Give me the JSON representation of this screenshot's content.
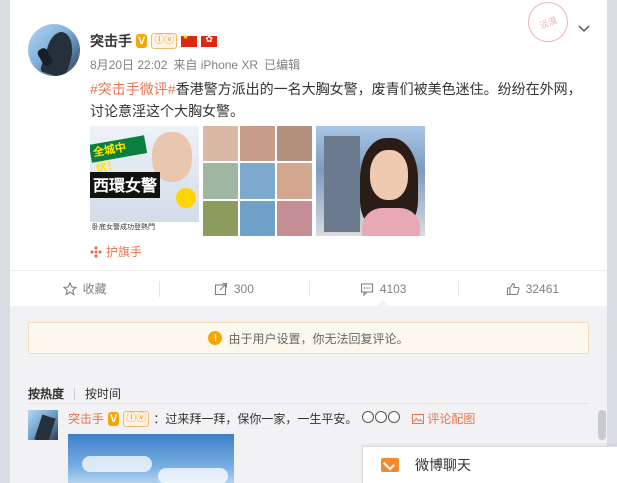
{
  "post": {
    "author": "突击手",
    "badges": {
      "verified": "V",
      "level": "ⓛⓥ"
    },
    "meta": {
      "date": "8月20日 22:02",
      "source": "来自 iPhone XR",
      "edited": "已编辑"
    },
    "stamp": "淡漠",
    "content": {
      "topic": "#突击手微评#",
      "text": "香港警方派出的一名大胸女警，废青们被美色迷住。纷纷在外网，讨论意淫这个大胸女警。"
    },
    "images": {
      "first": {
        "banner": "全城中伏！",
        "big": "西環女警",
        "caption": "卧底女警成功登熱門"
      }
    },
    "guardian": "护旗手"
  },
  "actions": {
    "favorite": {
      "label": "收藏"
    },
    "repost": {
      "count": "300"
    },
    "comment": {
      "count": "4103"
    },
    "like": {
      "count": "32461"
    }
  },
  "comments": {
    "notice": "由于用户设置，你无法回复评论。",
    "sort": {
      "hot": "按热度",
      "time": "按时间"
    },
    "items": [
      {
        "author": "突击手",
        "text": "：过来拜一拜，保你一家，一生平安。",
        "image_link": "评论配图"
      }
    ]
  },
  "chat": {
    "label": "微博聊天"
  },
  "colors": {
    "accent": "#eb7350",
    "badge": "#f7a500",
    "chat": "#f38a2e"
  }
}
